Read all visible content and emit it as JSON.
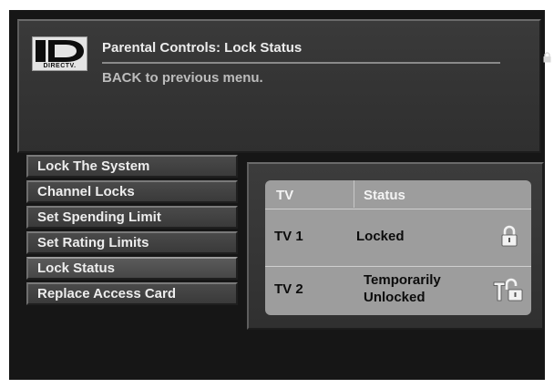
{
  "header": {
    "brand": "DIRECTV.",
    "title": "Parental Controls: Lock Status",
    "subtitle": "BACK to previous menu."
  },
  "indicator_icon": "lock-icon",
  "menu": {
    "items": [
      {
        "label": "Lock The System",
        "selected": false
      },
      {
        "label": "Channel Locks",
        "selected": false
      },
      {
        "label": "Set Spending Limit",
        "selected": false
      },
      {
        "label": "Set Rating Limits",
        "selected": false
      },
      {
        "label": "Lock Status",
        "selected": true
      },
      {
        "label": "Replace Access Card",
        "selected": false
      }
    ]
  },
  "status_table": {
    "headers": {
      "tv": "TV",
      "status": "Status"
    },
    "rows": [
      {
        "tv": "TV 1",
        "status": "Locked",
        "icon": "padlock-locked-icon"
      },
      {
        "tv": "TV 2",
        "status_line1": "Temporarily",
        "status_line2": "Unlocked",
        "icon": "temporarily-unlocked-icon"
      }
    ]
  }
}
